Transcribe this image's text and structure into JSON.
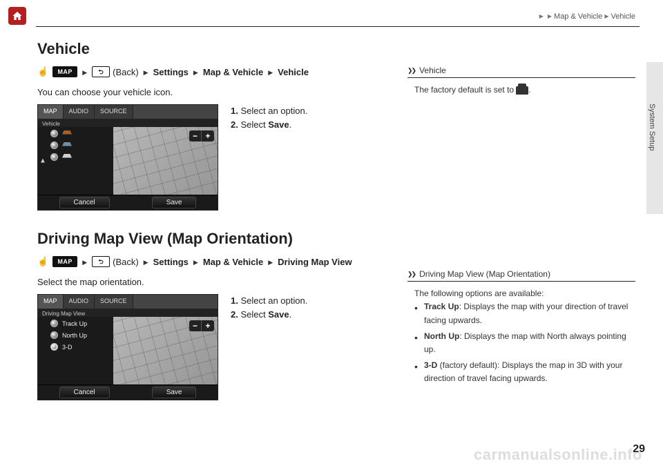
{
  "breadcrumb": {
    "a": "Map & Vehicle",
    "b": "Vehicle"
  },
  "sideLabel": "System Setup",
  "section1": {
    "title": "Vehicle",
    "mapBadge": "MAP",
    "back": "(Back)",
    "pathA": "Settings",
    "pathB": "Map & Vehicle",
    "pathC": "Vehicle",
    "desc": "You can choose your vehicle icon.",
    "step1": "Select an option.",
    "step2a": "Select ",
    "step2b": "Save",
    "step2c": "."
  },
  "ss": {
    "tabMap": "MAP",
    "tabAudio": "AUDIO",
    "tabSource": "SOURCE",
    "titleVehicle": "Vehicle",
    "titleDriving": "Driving Map View",
    "cancel": "Cancel",
    "save": "Save",
    "optTrack": "Track Up",
    "optNorth": "North Up",
    "opt3d": "3-D"
  },
  "section2": {
    "title": "Driving Map View (Map Orientation)",
    "mapBadge": "MAP",
    "back": "(Back)",
    "pathA": "Settings",
    "pathB": "Map & Vehicle",
    "pathC": "Driving Map View",
    "desc": "Select the map orientation.",
    "step1": "Select an option.",
    "step2a": "Select ",
    "step2b": "Save",
    "step2c": "."
  },
  "sb1": {
    "title": "Vehicle",
    "textA": "The factory default is set to ",
    "textB": "."
  },
  "sb2": {
    "title": "Driving Map View (Map Orientation)",
    "intro": "The following options are available:",
    "li1a": "Track Up",
    "li1b": ": Displays the map with your direction of travel facing upwards.",
    "li2a": "North Up",
    "li2b": ": Displays the map with North always pointing up.",
    "li3a": "3-D",
    "li3b": " (factory default): Displays the map in 3D with your direction of travel facing upwards."
  },
  "pageNum": "29",
  "watermark": "carmanualsonline.info"
}
